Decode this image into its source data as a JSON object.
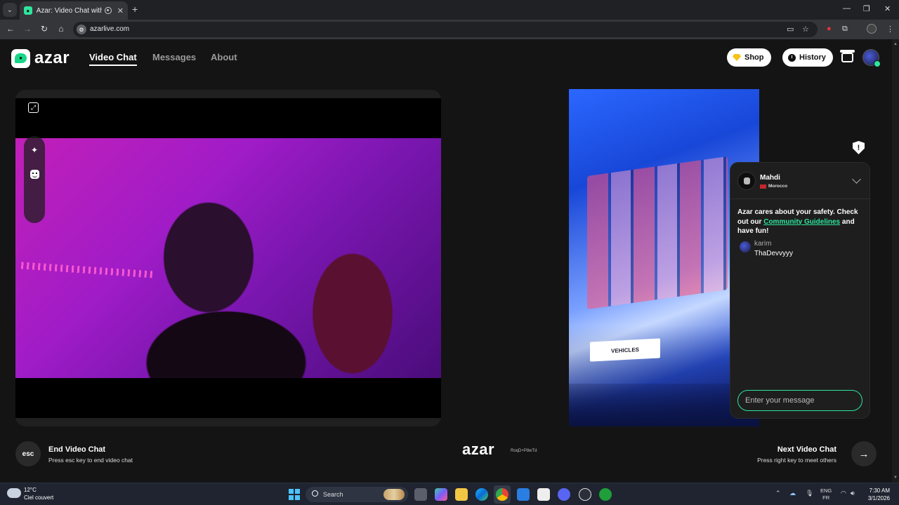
{
  "browser": {
    "tab_title": "Azar: Video Chat with New",
    "url": "azarlive.com"
  },
  "header": {
    "logo_text": "azar",
    "nav": [
      {
        "label": "Video Chat",
        "active": true
      },
      {
        "label": "Messages",
        "active": false
      },
      {
        "label": "About",
        "active": false
      }
    ],
    "shop_label": "Shop",
    "history_label": "History",
    "accent_color": "#2ee59d"
  },
  "partner": {
    "watermark": "azar",
    "watermark_code": "RoqD+P8wTd",
    "sign_text": "VEHICLES"
  },
  "chat": {
    "name": "Mahdi",
    "country": "Morocco",
    "safety_prefix": "Azar cares about your safety. Check out our ",
    "safety_link": "Community Guidelines",
    "safety_suffix": " and have fun!",
    "messages": [
      {
        "sender": "karim",
        "text": "ThaDevvyyy"
      }
    ],
    "input_placeholder": "Enter your message"
  },
  "controls": {
    "esc_label": "esc",
    "end_title": "End Video Chat",
    "end_sub": "Press esc key to end video chat",
    "next_title": "Next Video Chat",
    "next_sub": "Press right key to meet others"
  },
  "taskbar": {
    "temp": "12°C",
    "weather": "Ciel couvert",
    "search_label": "Search",
    "lang_1": "ENG",
    "lang_2": "FR",
    "time": "7:30 AM",
    "date": "3/1/2026"
  }
}
